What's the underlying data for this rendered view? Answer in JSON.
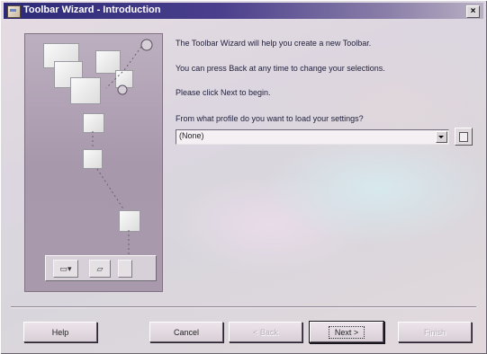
{
  "window": {
    "title": "Toolbar Wizard - Introduction",
    "close_label": "×"
  },
  "content": {
    "intro_line": "The Toolbar Wizard will help you create a new Toolbar.",
    "back_line": "You can press Back at any time to change your selections.",
    "next_line": "Please click Next to begin.",
    "profile_prompt": "From what profile do you want to load your settings?",
    "profile_selected": "(None)"
  },
  "buttons": {
    "help": "Help",
    "cancel": "Cancel",
    "back": "< Back",
    "next": "Next >",
    "finish": "Finish"
  },
  "icons": {
    "title": "toolbar-wizard-icon",
    "illustration": "toolbar-wizard-illustration",
    "browse": "browse-file-icon",
    "dropdown": "chevron-down-icon"
  }
}
